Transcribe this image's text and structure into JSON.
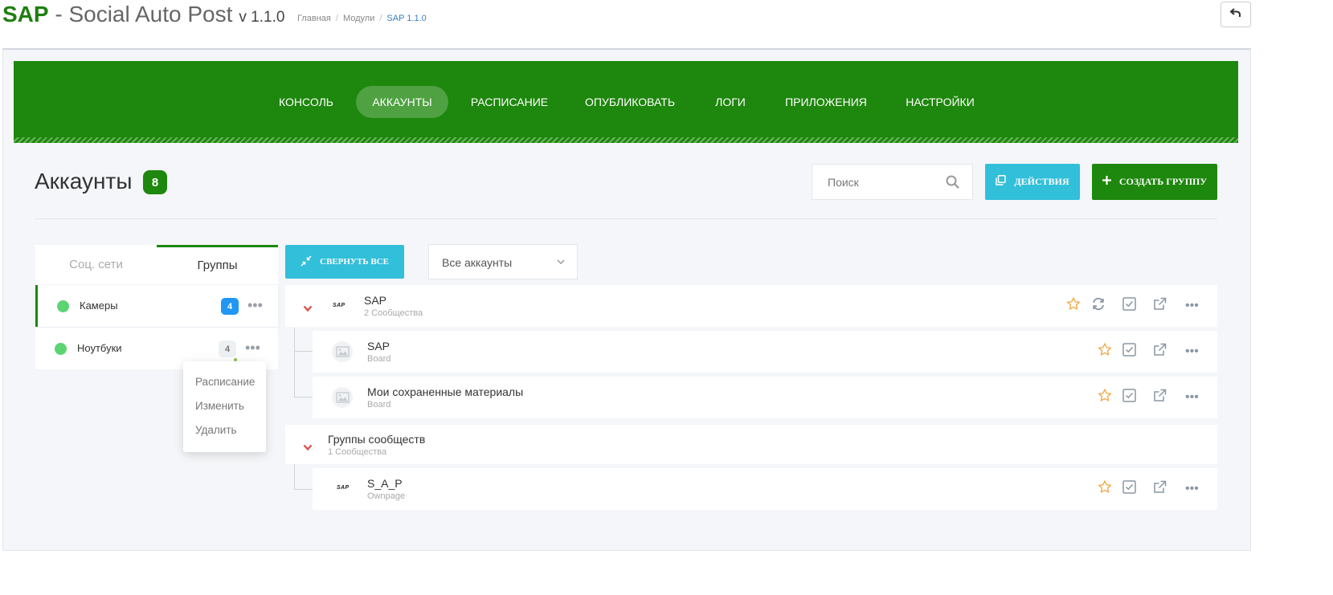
{
  "header": {
    "brand_short": "SAP",
    "brand_rest": " - Social Auto Post",
    "version": "v 1.1.0",
    "breadcrumbs": [
      "Главная",
      "Модули",
      "SAP 1.1.0"
    ],
    "back_icon": "undo-icon"
  },
  "nav": {
    "items": [
      "КОНСОЛЬ",
      "АККАУНТЫ",
      "РАСПИСАНИЕ",
      "ОПУБЛИКОВАТЬ",
      "ЛОГИ",
      "ПРИЛОЖЕНИЯ",
      "НАСТРОЙКИ"
    ],
    "active_index": 1
  },
  "page": {
    "title": "Аккаунты",
    "count": "8",
    "search_placeholder": "Поиск",
    "actions_label": "ДЕЙСТВИЯ",
    "create_group_label": "СОЗДАТЬ ГРУППУ"
  },
  "left_panel": {
    "tabs": [
      "Соц. сети",
      "Группы"
    ],
    "active_tab": 1,
    "groups": [
      {
        "name": "Камеры",
        "count": "4"
      },
      {
        "name": "Ноутбуки",
        "count": "4"
      }
    ],
    "context_menu": [
      "Расписание",
      "Изменить",
      "Удалить"
    ]
  },
  "toolbar": {
    "collapse_label": "СВЕРНУТЬ ВСЕ",
    "filter_value": "Все аккаунты"
  },
  "tree": {
    "parents": [
      {
        "title": "SAP",
        "subtitle": "2 Сообщества",
        "logo": "SAP"
      },
      {
        "title": "Группы сообществ",
        "subtitle": "1 Сообщества"
      }
    ],
    "children": [
      {
        "title": "SAP",
        "subtitle": "Board"
      },
      {
        "title": "Мои сохраненные материалы",
        "subtitle": "Board"
      },
      {
        "title": "S_A_P",
        "subtitle": "Ownpage",
        "logo": "SAP"
      }
    ]
  },
  "colors": {
    "brand_green": "#1e870d",
    "cyan": "#31bfd9",
    "blue_badge": "#2196f3",
    "star": "#f0ad4e",
    "chevron_red": "#d9534f"
  }
}
